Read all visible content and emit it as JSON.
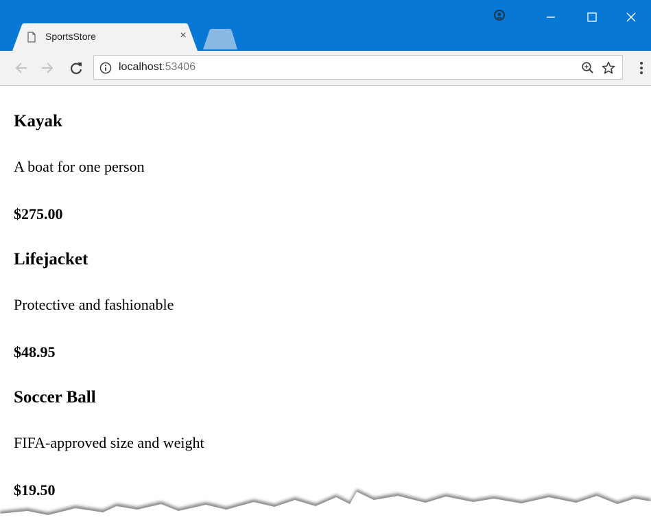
{
  "browser": {
    "tab": {
      "title": "SportsStore",
      "close_glyph": "×",
      "page_icon": "page-icon"
    },
    "window_controls": {
      "profile_icon": "profile-icon",
      "minimize_icon": "minimize-icon",
      "maximize_icon": "maximize-icon",
      "close_icon": "close-icon"
    },
    "toolbar": {
      "back_icon": "back-arrow-icon",
      "forward_icon": "forward-arrow-icon",
      "reload_icon": "reload-icon",
      "info_icon": "info-icon",
      "url_host": "localhost",
      "url_port": ":53406",
      "zoom_icon": "zoom-icon",
      "bookmark_icon": "star-icon",
      "menu_icon": "kebab-menu-icon"
    },
    "colors": {
      "titlebar": "#0878d4",
      "toolbar": "#f2f2f2",
      "page_background": "#ffffff"
    }
  },
  "products": [
    {
      "name": "Kayak",
      "description": "A boat for one person",
      "price": "$275.00"
    },
    {
      "name": "Lifejacket",
      "description": "Protective and fashionable",
      "price": "$48.95"
    },
    {
      "name": "Soccer Ball",
      "description": "FIFA-approved size and weight",
      "price": "$19.50"
    }
  ]
}
